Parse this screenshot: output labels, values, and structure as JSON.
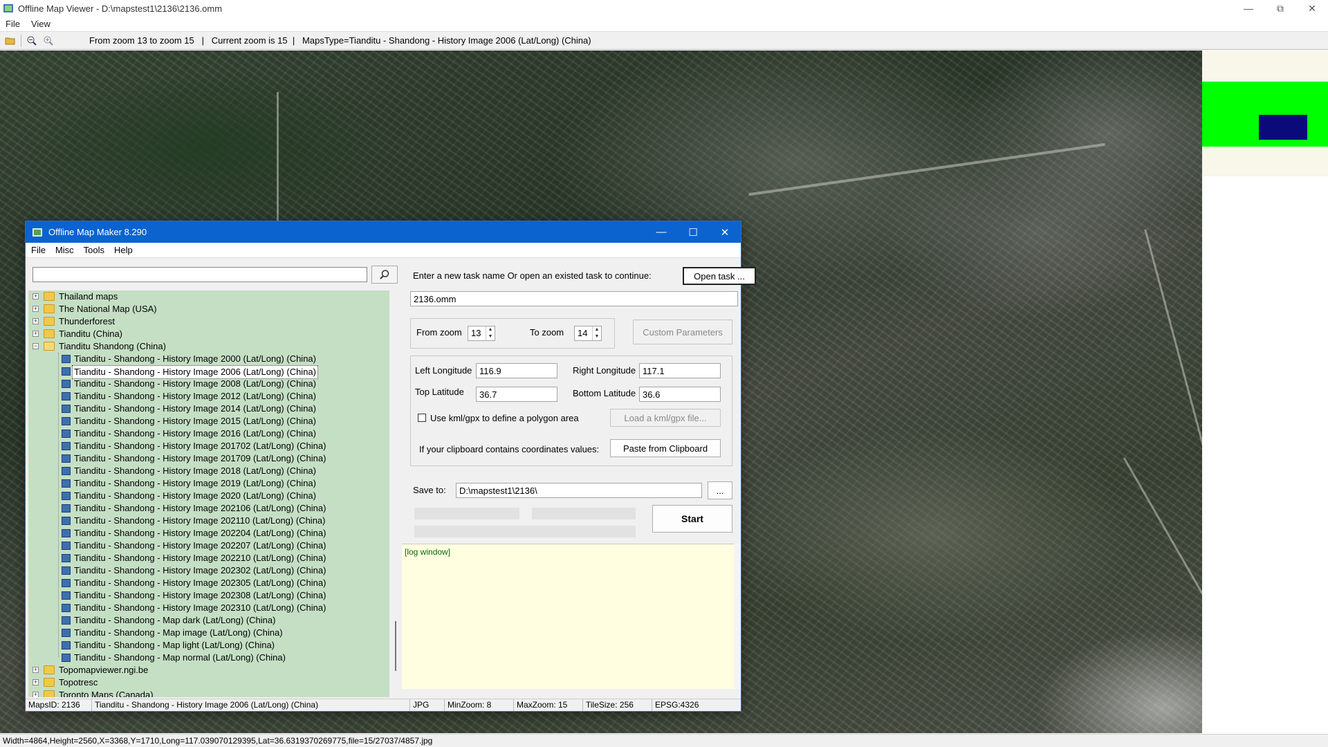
{
  "viewer": {
    "title": "Offline Map Viewer - D:\\mapstest1\\2136\\2136.omm",
    "menu": [
      "File",
      "View"
    ],
    "toolbar_text": "From zoom 13 to zoom 15   |   Current zoom is 15  |   MapsType=Tianditu - Shandong - History Image 2006 (Lat/Long) (China)",
    "statusbar": "Width=4864,Height=2560,X=3368,Y=1710,Long=117.039070129395,Lat=36.6319370269775,file=15/27037/4857.jpg"
  },
  "dialog": {
    "title": "Offline Map Maker 8.290",
    "menu": [
      "File",
      "Misc",
      "Tools",
      "Help"
    ],
    "search_value": "",
    "tree": [
      {
        "level": 0,
        "type": "folder",
        "expand": "+",
        "label": "Thailand maps"
      },
      {
        "level": 0,
        "type": "folder",
        "expand": "+",
        "label": "The National Map (USA)"
      },
      {
        "level": 0,
        "type": "folder",
        "expand": "+",
        "label": "Thunderforest"
      },
      {
        "level": 0,
        "type": "folder",
        "expand": "+",
        "label": "Tianditu (China)"
      },
      {
        "level": 0,
        "type": "folder-open",
        "expand": "−",
        "label": "Tianditu Shandong (China)"
      },
      {
        "level": 1,
        "type": "map",
        "label": "Tianditu - Shandong - History Image 2000 (Lat/Long) (China)"
      },
      {
        "level": 1,
        "type": "map",
        "label": "Tianditu - Shandong - History Image 2006 (Lat/Long) (China)",
        "selected": true
      },
      {
        "level": 1,
        "type": "map",
        "label": "Tianditu - Shandong - History Image 2008 (Lat/Long) (China)"
      },
      {
        "level": 1,
        "type": "map",
        "label": "Tianditu - Shandong - History Image 2012 (Lat/Long) (China)"
      },
      {
        "level": 1,
        "type": "map",
        "label": "Tianditu - Shandong - History Image 2014 (Lat/Long) (China)"
      },
      {
        "level": 1,
        "type": "map",
        "label": "Tianditu - Shandong - History Image 2015 (Lat/Long) (China)"
      },
      {
        "level": 1,
        "type": "map",
        "label": "Tianditu - Shandong - History Image 2016 (Lat/Long) (China)"
      },
      {
        "level": 1,
        "type": "map",
        "label": "Tianditu - Shandong - History Image 201702 (Lat/Long) (China)"
      },
      {
        "level": 1,
        "type": "map",
        "label": "Tianditu - Shandong - History Image 201709 (Lat/Long) (China)"
      },
      {
        "level": 1,
        "type": "map",
        "label": "Tianditu - Shandong - History Image 2018 (Lat/Long) (China)"
      },
      {
        "level": 1,
        "type": "map",
        "label": "Tianditu - Shandong - History Image 2019 (Lat/Long) (China)"
      },
      {
        "level": 1,
        "type": "map",
        "label": "Tianditu - Shandong - History Image 2020 (Lat/Long) (China)"
      },
      {
        "level": 1,
        "type": "map",
        "label": "Tianditu - Shandong - History Image 202106 (Lat/Long) (China)"
      },
      {
        "level": 1,
        "type": "map",
        "label": "Tianditu - Shandong - History Image 202110 (Lat/Long) (China)"
      },
      {
        "level": 1,
        "type": "map",
        "label": "Tianditu - Shandong - History Image 202204 (Lat/Long) (China)"
      },
      {
        "level": 1,
        "type": "map",
        "label": "Tianditu - Shandong - History Image 202207 (Lat/Long) (China)"
      },
      {
        "level": 1,
        "type": "map",
        "label": "Tianditu - Shandong - History Image 202210 (Lat/Long) (China)"
      },
      {
        "level": 1,
        "type": "map",
        "label": "Tianditu - Shandong - History Image 202302 (Lat/Long) (China)"
      },
      {
        "level": 1,
        "type": "map",
        "label": "Tianditu - Shandong - History Image 202305 (Lat/Long) (China)"
      },
      {
        "level": 1,
        "type": "map",
        "label": "Tianditu - Shandong - History Image 202308 (Lat/Long) (China)"
      },
      {
        "level": 1,
        "type": "map",
        "label": "Tianditu - Shandong - History Image 202310 (Lat/Long) (China)"
      },
      {
        "level": 1,
        "type": "map",
        "label": "Tianditu - Shandong - Map dark (Lat/Long) (China)"
      },
      {
        "level": 1,
        "type": "map",
        "label": "Tianditu - Shandong - Map image (Lat/Long) (China)"
      },
      {
        "level": 1,
        "type": "map",
        "label": "Tianditu - Shandong - Map light (Lat/Long) (China)"
      },
      {
        "level": 1,
        "type": "map",
        "label": "Tianditu - Shandong - Map normal (Lat/Long) (China)"
      },
      {
        "level": 0,
        "type": "folder",
        "expand": "+",
        "label": "Topomapviewer.ngi.be"
      },
      {
        "level": 0,
        "type": "folder",
        "expand": "+",
        "label": "Topotresc"
      },
      {
        "level": 0,
        "type": "folder",
        "expand": "+",
        "label": "Toronto Maps (Canada)"
      }
    ],
    "task": {
      "prompt": "Enter a new task name Or open an existed task to continue:",
      "open_button": "Open task ...",
      "task_name": "2136.omm"
    },
    "zoom": {
      "from_label": "From zoom",
      "from_value": "13",
      "to_label": "To zoom",
      "to_value": "14",
      "custom_button": "Custom Parameters"
    },
    "coords": {
      "left_lon_label": "Left Longitude",
      "left_lon": "116.9",
      "right_lon_label": "Right Longitude",
      "right_lon": "117.1",
      "top_lat_label": "Top Latitude",
      "top_lat": "36.7",
      "bottom_lat_label": "Bottom Latitude",
      "bottom_lat": "36.6",
      "kml_checkbox_label": "Use kml/gpx to define a polygon area",
      "load_kml_button": "Load a kml/gpx file...",
      "clipboard_label": "If your clipboard contains coordinates values:",
      "paste_button": "Paste from Clipboard"
    },
    "save": {
      "label": "Save to:",
      "path": "D:\\mapstest1\\2136\\",
      "browse_button": "...",
      "start_button": "Start"
    },
    "log_text": "[log window]",
    "status": {
      "maps_id": "MapsID: 2136",
      "map_name": "Tianditu - Shandong - History Image 2006 (Lat/Long) (China)",
      "format": "JPG",
      "min_zoom": "MinZoom: 8",
      "max_zoom": "MaxZoom: 15",
      "tile_size": "TileSize: 256",
      "epsg": "EPSG:4326"
    }
  }
}
